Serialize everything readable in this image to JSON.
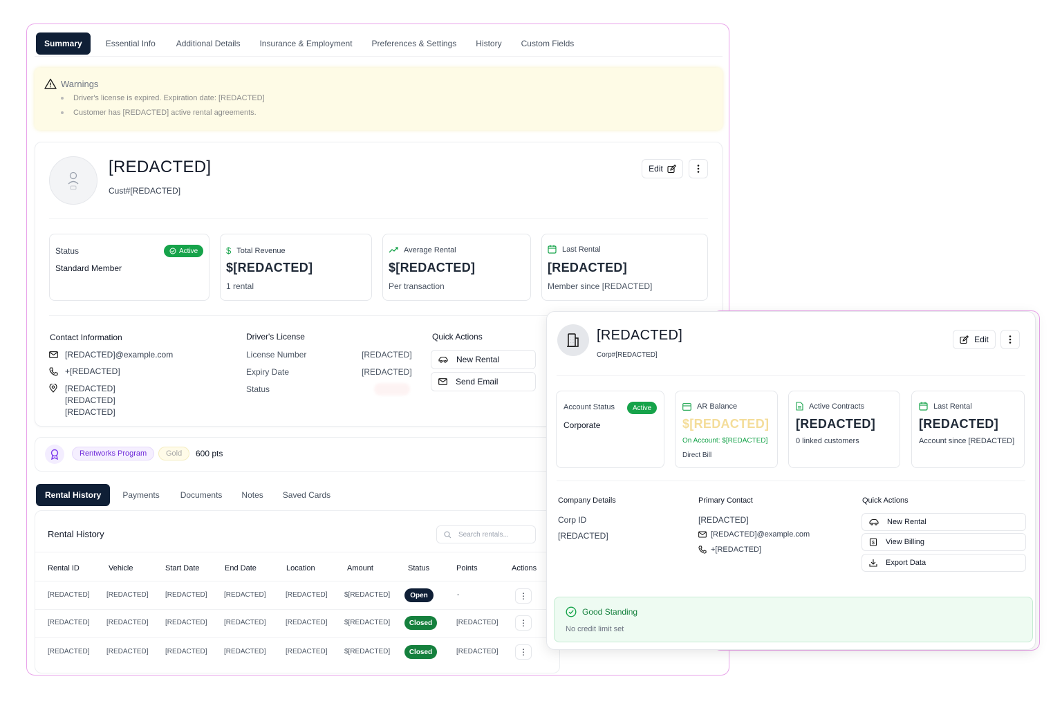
{
  "tabs": [
    "Summary",
    "Essential Info",
    "Additional Details",
    "Insurance & Employment",
    "Preferences & Settings",
    "History",
    "Custom Fields"
  ],
  "warnings": {
    "title": "Warnings",
    "items": [
      "Driver's license is expired. Expiration date: [REDACTED]",
      "Customer has [REDACTED] active rental agreements."
    ]
  },
  "customer": {
    "name": "[REDACTED]",
    "id": "Cust#[REDACTED]",
    "edit_label": "Edit",
    "stats": {
      "status_label": "Status",
      "status_badge": "Active",
      "status_value": "Standard Member",
      "revenue_label": "Total Revenue",
      "revenue_value": "$[REDACTED]",
      "revenue_sub": "1 rental",
      "avg_label": "Average Rental",
      "avg_value": "$[REDACTED]",
      "avg_sub": "Per transaction",
      "last_label": "Last Rental",
      "last_value": "[REDACTED]",
      "last_sub": "Member since [REDACTED]"
    },
    "contact": {
      "title": "Contact Information",
      "email": "[REDACTED]@example.com",
      "phone": "+[REDACTED]",
      "address": [
        "[REDACTED]",
        "[REDACTED]",
        "[REDACTED]"
      ]
    },
    "license": {
      "title": "Driver's License",
      "number_label": "License Number",
      "number_value": "[REDACTED]",
      "expiry_label": "Expiry Date",
      "expiry_value": "[REDACTED]",
      "status_label": "Status"
    },
    "quick_actions": {
      "title": "Quick Actions",
      "new_rental": "New Rental",
      "send_email": "Send Email"
    }
  },
  "loyalty": {
    "program": "Rentworks Program",
    "tier": "Gold",
    "points": "600 pts"
  },
  "subtabs": [
    "Rental History",
    "Payments",
    "Documents",
    "Notes",
    "Saved Cards"
  ],
  "rental_history": {
    "title": "Rental History",
    "search_placeholder": "Search rentals...",
    "columns": [
      "Rental ID",
      "Vehicle",
      "Start Date",
      "End Date",
      "Location",
      "Amount",
      "Status",
      "Points",
      "Actions"
    ],
    "rows": [
      {
        "id": "[REDACTED]",
        "vehicle": "[REDACTED]",
        "start": "[REDACTED]",
        "end": "[REDACTED]",
        "location": "[REDACTED]",
        "amount": "$[REDACTED]",
        "status": "Open",
        "points": "-"
      },
      {
        "id": "[REDACTED]",
        "vehicle": "[REDACTED]",
        "start": "[REDACTED]",
        "end": "[REDACTED]",
        "location": "[REDACTED]",
        "amount": "$[REDACTED]",
        "status": "Closed",
        "points": "[REDACTED]"
      },
      {
        "id": "[REDACTED]",
        "vehicle": "[REDACTED]",
        "start": "[REDACTED]",
        "end": "[REDACTED]",
        "location": "[REDACTED]",
        "amount": "$[REDACTED]",
        "status": "Closed",
        "points": "[REDACTED]"
      }
    ]
  },
  "corp": {
    "name": "[REDACTED]",
    "id": "Corp#[REDACTED]",
    "edit_label": "Edit",
    "stats": {
      "status_label": "Account Status",
      "status_badge": "Active",
      "status_value": "Corporate",
      "ar_label": "AR Balance",
      "ar_value": "$[REDACTED]",
      "ar_sub": "On Account: $[REDACTED]",
      "ar_sub2": "Direct Bill",
      "contracts_label": "Active Contracts",
      "contracts_value": "[REDACTED]",
      "contracts_sub": "0 linked customers",
      "last_label": "Last Rental",
      "last_value": "[REDACTED]",
      "last_sub": "Account since [REDACTED]"
    },
    "company": {
      "title": "Company Details",
      "corp_id_label": "Corp ID",
      "corp_id_value": "[REDACTED]"
    },
    "contact": {
      "title": "Primary Contact",
      "name": "[REDACTED]",
      "email": "[REDACTED]@example.com",
      "phone": "+[REDACTED]"
    },
    "quick_actions": {
      "title": "Quick Actions",
      "new_rental": "New Rental",
      "view_billing": "View Billing",
      "export": "Export Data"
    },
    "standing": {
      "title": "Good Standing",
      "sub": "No credit limit set"
    }
  },
  "colors": {
    "primary": "#0f1f36",
    "success": "#16a34a",
    "warning_bg": "#fefbe6",
    "accent_purple": "#6d28d9",
    "outline": "#e9a3ea"
  }
}
